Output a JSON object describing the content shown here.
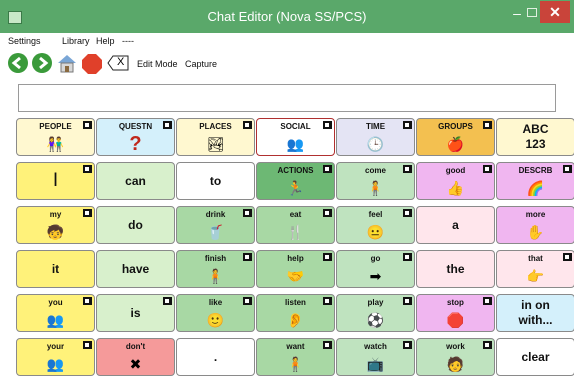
{
  "window": {
    "title": "Chat Editor (Nova SS/PCS)",
    "minimize": "–",
    "close": "✕"
  },
  "menu": {
    "items": [
      "Settings",
      "Library",
      "Help",
      "----"
    ]
  },
  "toolbar": {
    "edit_mode": "Edit Mode",
    "capture": "Capture",
    "clear_symbol": "X"
  },
  "message_bar": {
    "value": ""
  },
  "grid": {
    "rows": [
      [
        {
          "label": "PEOPLE",
          "style": "small",
          "bg": "#fff8d0",
          "icon": "👫",
          "folder": true
        },
        {
          "label": "QUESTN",
          "style": "small",
          "bg": "#d4f0fb",
          "icon": "?",
          "folder": true
        },
        {
          "label": "PLACES",
          "style": "small",
          "bg": "#fff8d0",
          "icon": "🏞",
          "folder": true
        },
        {
          "label": "SOCIAL",
          "style": "small",
          "bg": "#ffffff",
          "icon": "👥",
          "folder": true
        },
        {
          "label": "TIME",
          "style": "small",
          "bg": "#e4e4f4",
          "icon": "🕒",
          "folder": true
        },
        {
          "label": "GROUPS",
          "style": "small",
          "bg": "#f3c050",
          "icon": "🍎",
          "folder": true
        },
        {
          "label": "ABC\n123",
          "style": "multi",
          "bg": "#fff8d0",
          "icon": "",
          "folder": false
        }
      ],
      [
        {
          "label": "I",
          "style": "big",
          "bg": "#fff27a",
          "icon": "",
          "folder": true
        },
        {
          "label": "can",
          "style": "mid",
          "bg": "#d8f0cc",
          "icon": "",
          "folder": false
        },
        {
          "label": "to",
          "style": "mid",
          "bg": "#ffffff",
          "icon": "",
          "folder": false
        },
        {
          "label": "ACTIONS",
          "style": "small",
          "bg": "#6db874",
          "icon": "🏃",
          "folder": true
        },
        {
          "label": "come",
          "style": "small",
          "bg": "#bfe3bf",
          "icon": "🧍",
          "folder": true
        },
        {
          "label": "good",
          "style": "small",
          "bg": "#f0b6f0",
          "icon": "👍",
          "folder": true
        },
        {
          "label": "DESCRB",
          "style": "small",
          "bg": "#f0b6f0",
          "icon": "🌈",
          "folder": true
        }
      ],
      [
        {
          "label": "my",
          "style": "small",
          "bg": "#fff27a",
          "icon": "🧒",
          "folder": true
        },
        {
          "label": "do",
          "style": "mid",
          "bg": "#d8f0cc",
          "icon": "",
          "folder": false
        },
        {
          "label": "drink",
          "style": "small",
          "bg": "#a8d8a4",
          "icon": "🥤",
          "folder": true
        },
        {
          "label": "eat",
          "style": "small",
          "bg": "#a8d8a4",
          "icon": "🍴",
          "folder": true
        },
        {
          "label": "feel",
          "style": "small",
          "bg": "#bfe3bf",
          "icon": "😐",
          "folder": true
        },
        {
          "label": "a",
          "style": "mid",
          "bg": "#ffe6ec",
          "icon": "",
          "folder": false
        },
        {
          "label": "more",
          "style": "small",
          "bg": "#f0b6f0",
          "icon": "✋",
          "folder": false
        }
      ],
      [
        {
          "label": "it",
          "style": "mid",
          "bg": "#fff27a",
          "icon": "",
          "folder": false
        },
        {
          "label": "have",
          "style": "mid",
          "bg": "#d8f0cc",
          "icon": "",
          "folder": false
        },
        {
          "label": "finish",
          "style": "small",
          "bg": "#a8d8a4",
          "icon": "🧍",
          "folder": true
        },
        {
          "label": "help",
          "style": "small",
          "bg": "#a8d8a4",
          "icon": "🤝",
          "folder": true
        },
        {
          "label": "go",
          "style": "small",
          "bg": "#bfe3bf",
          "icon": "➡",
          "folder": true
        },
        {
          "label": "the",
          "style": "mid",
          "bg": "#ffe6ec",
          "icon": "",
          "folder": false
        },
        {
          "label": "that",
          "style": "small",
          "bg": "#ffe6ec",
          "icon": "👉",
          "folder": true
        }
      ],
      [
        {
          "label": "you",
          "style": "small",
          "bg": "#fff27a",
          "icon": "👥",
          "folder": true
        },
        {
          "label": "is",
          "style": "mid",
          "bg": "#d8f0cc",
          "icon": "",
          "folder": true
        },
        {
          "label": "like",
          "style": "small",
          "bg": "#a8d8a4",
          "icon": "🙂",
          "folder": true
        },
        {
          "label": "listen",
          "style": "small",
          "bg": "#a8d8a4",
          "icon": "👂",
          "folder": true
        },
        {
          "label": "play",
          "style": "small",
          "bg": "#bfe3bf",
          "icon": "⚽",
          "folder": true
        },
        {
          "label": "stop",
          "style": "small",
          "bg": "#f0b6f0",
          "icon": "🛑",
          "folder": true
        },
        {
          "label": "in on\nwith...",
          "style": "multi",
          "bg": "#d4f0fb",
          "icon": "",
          "folder": false
        }
      ],
      [
        {
          "label": "your",
          "style": "small",
          "bg": "#fff27a",
          "icon": "👥",
          "folder": true
        },
        {
          "label": "don't",
          "style": "small",
          "bg": "#f59a9a",
          "icon": "✖",
          "folder": false
        },
        {
          "label": ".",
          "style": "mid",
          "bg": "#ffffff",
          "icon": "",
          "folder": false
        },
        {
          "label": "want",
          "style": "small",
          "bg": "#a8d8a4",
          "icon": "🧍",
          "folder": true
        },
        {
          "label": "watch",
          "style": "small",
          "bg": "#bfe3bf",
          "icon": "📺",
          "folder": true
        },
        {
          "label": "work",
          "style": "small",
          "bg": "#bfe3bf",
          "icon": "🧑",
          "folder": true
        },
        {
          "label": "clear",
          "style": "mid",
          "bg": "#ffffff",
          "icon": "",
          "folder": false
        }
      ]
    ]
  }
}
